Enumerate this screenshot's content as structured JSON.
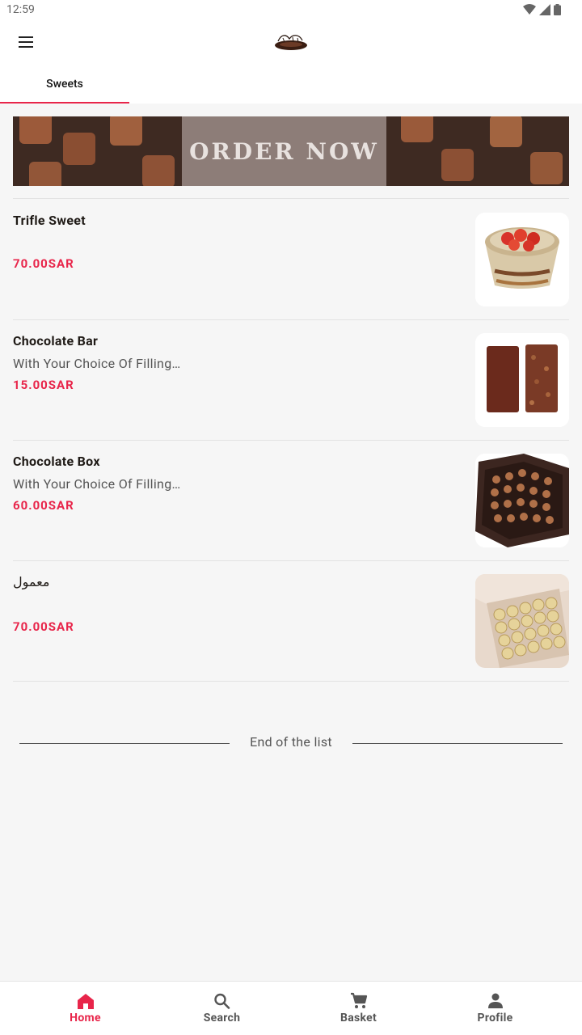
{
  "status_bar": {
    "time": "12:59"
  },
  "tabs": [
    {
      "label": "Sweets",
      "active": true
    }
  ],
  "banner": {
    "text": "ORDER NOW"
  },
  "products": [
    {
      "name": "Trifle Sweet",
      "description": "",
      "price": "70.00SAR",
      "image_icon": "trifle-cup-image"
    },
    {
      "name": "Chocolate Bar",
      "description": "With Your Choice Of Filling…",
      "price": "15.00SAR",
      "image_icon": "chocolate-bar-image"
    },
    {
      "name": "Chocolate Box",
      "description": "With Your Choice Of Filling…",
      "price": "60.00SAR",
      "image_icon": "chocolate-box-image"
    },
    {
      "name": "معمول",
      "description": "",
      "price": "70.00SAR",
      "image_icon": "maamoul-box-image"
    }
  ],
  "end_of_list": "End of the list",
  "bottom_nav": [
    {
      "label": "Home",
      "icon": "home-icon",
      "active": true
    },
    {
      "label": "Search",
      "icon": "search-icon",
      "active": false
    },
    {
      "label": "Basket",
      "icon": "cart-icon",
      "active": false
    },
    {
      "label": "Profile",
      "icon": "person-icon",
      "active": false
    }
  ],
  "colors": {
    "accent": "#e8254a",
    "background": "#f6f6f6"
  }
}
